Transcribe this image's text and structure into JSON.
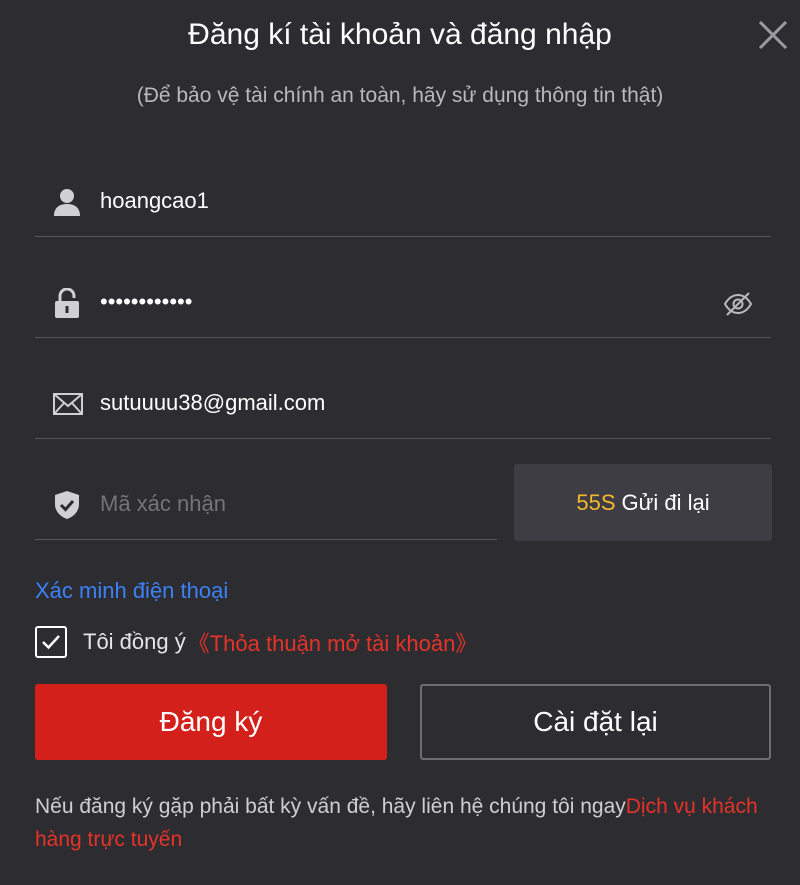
{
  "header": {
    "title": "Đăng kí tài khoản và đăng nhập",
    "subtitle": "(Để bảo vệ tài chính an toàn, hãy sử dụng thông tin thật)",
    "close_icon": "close-icon"
  },
  "form": {
    "username": {
      "value": "hoangcao1",
      "icon": "user-icon"
    },
    "password": {
      "value": "••••••••••••",
      "icon": "lock-icon",
      "toggle_icon": "eye-slash-icon"
    },
    "email": {
      "value": "sutuuuu38@gmail.com",
      "icon": "envelope-icon"
    },
    "code": {
      "placeholder": "Mã xác nhận",
      "icon": "shield-check-icon"
    },
    "resend": {
      "countdown": "55S",
      "label": "Gửi đi lại"
    }
  },
  "verify_phone_link": "Xác minh điện thoại",
  "agreement": {
    "checked": true,
    "text": "Tôi đồng ý",
    "link": "《Thỏa thuận mở tài khoản》"
  },
  "buttons": {
    "register": "Đăng ký",
    "reset": "Cài đặt lại"
  },
  "help": {
    "text": "Nếu đăng ký gặp phải bất kỳ vấn đề, hãy liên hệ chúng tôi ngay",
    "link": "Dịch vụ khách hàng trực tuyến"
  },
  "colors": {
    "background": "#2c2c31",
    "primary_red": "#d3201b",
    "link_blue": "#3b82f6",
    "countdown_yellow": "#f5b82e"
  }
}
